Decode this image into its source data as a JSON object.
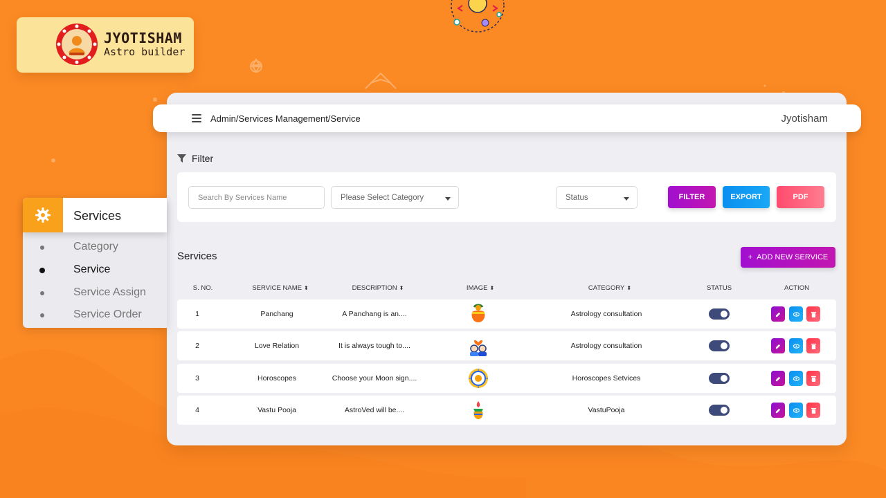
{
  "brand": {
    "title": "JYOTISHAM",
    "subtitle": "Astro builder",
    "colors": {
      "background": "#fb8a24",
      "card": "#fce39a",
      "emblem_ring": "#e11d1d"
    }
  },
  "topbar": {
    "breadcrumb": "Admin/Services Management/Service",
    "user": "Jyotisham",
    "menu_icon": "hamburger-icon"
  },
  "filter": {
    "heading": "Filter",
    "icon": "funnel-icon",
    "search_placeholder": "Search By Services Name",
    "category_placeholder": "Please Select Category",
    "status_placeholder": "Status",
    "filter_label": "FILTER",
    "export_label": "EXPORT",
    "pdf_label": "PDF"
  },
  "list": {
    "title": "Services",
    "add_label": "ADD NEW SERVICE",
    "add_icon": "+",
    "columns": [
      "S. NO.",
      "SERVICE NAME",
      "DESCRIPTION",
      "IMAGE",
      "CATEGORY",
      "STATUS",
      "ACTION"
    ],
    "rows": [
      {
        "sno": "1",
        "name": "Panchang",
        "description": "A Panchang is an....",
        "image": "kalash-icon",
        "category": "Astrology consultation",
        "status": true
      },
      {
        "sno": "2",
        "name": "Love Relation",
        "description": "It is always tough to....",
        "image": "couple-heart-icon",
        "category": "Astrology consultation",
        "status": true
      },
      {
        "sno": "3",
        "name": "Horoscopes",
        "description": "Choose your Moon sign....",
        "image": "zodiac-wheel-icon",
        "category": "Horoscopes Setvices",
        "status": true
      },
      {
        "sno": "4",
        "name": "Vastu Pooja",
        "description": "AstroVed will be....",
        "image": "pooja-kalash-icon",
        "category": "VastuPooja",
        "status": true
      }
    ]
  },
  "sidebar": {
    "title": "Services",
    "icon": "gear-icon",
    "items": [
      {
        "label": "Category",
        "active": false
      },
      {
        "label": "Service",
        "active": true
      },
      {
        "label": "Service Assign",
        "active": false
      },
      {
        "label": "Service Order",
        "active": false
      }
    ]
  }
}
